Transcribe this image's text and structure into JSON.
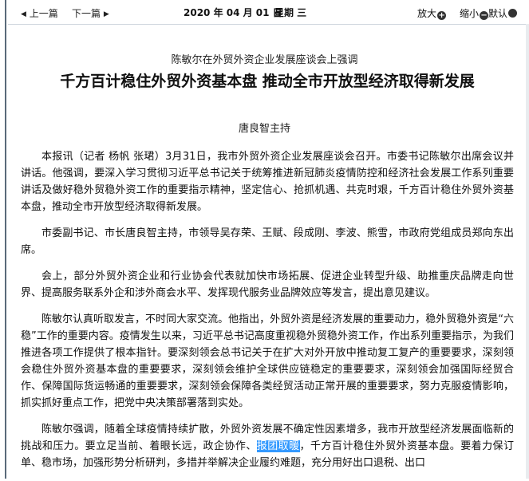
{
  "toolbar": {
    "prev_label": "上一篇",
    "next_label": "下一篇",
    "date": "2020 年 04 月 01 日",
    "weekday": "星期 三",
    "zoom_in_label": "放大",
    "zoom_out_label": "缩小",
    "reset_label": "默认"
  },
  "icons": {
    "prev": "triangle-left-icon",
    "next": "triangle-right-icon",
    "zoom_in": "plus-circle-icon",
    "zoom_out": "minus-circle-icon",
    "reset": "circle-icon"
  },
  "article": {
    "kicker": "陈敏尔在外贸外资企业发展座谈会上强调",
    "title": "千方百计稳住外贸外资基本盘  推动全市开放型经济取得新发展",
    "subtitle": "唐良智主持",
    "paragraphs": [
      "本报讯（记者 杨帆 张珺）3月31日，我市外贸外资企业发展座谈会召开。市委书记陈敏尔出席会议并讲话。他强调，要深入学习贯彻习近平总书记关于统筹推进新冠肺炎疫情防控和经济社会发展工作系列重要讲话及做好稳外贸稳外资工作的重要指示精神，坚定信心、抢抓机遇、共克时艰，千方百计稳住外贸外资基本盘，推动全市开放型经济取得新发展。",
      "市委副书记、市长唐良智主持，市领导吴存荣、王赋、段成刚、李波、熊雪，市政府党组成员郑向东出席。",
      "会上，部分外贸外资企业和行业协会代表就加快市场拓展、促进企业转型升级、助推重庆品牌走向世界、提高服务联系外企和涉外商会水平、发挥现代服务业品牌效应等发言，提出意见建议。",
      "陈敏尔认真听取发言，不时同大家交流。他指出，外贸外资是经济发展的重要动力，稳外贸稳外资是“六稳”工作的重要内容。疫情发生以来，习近平总书记高度重视稳外贸稳外资工作，作出系列重要指示，为我们推进各项工作提供了根本指针。要深刻领会总书记关于在扩大对外开放中推动复工复产的重要要求，深刻领会稳住外贸外资基本盘的重要要求，深刻领会维护全球供应链稳定的重要要求，深刻领会加强国际经贸合作、保障国际货运畅通的重要要求，深刻领会保障各类经贸活动正常开展的重要要求，努力克服疫情影响，抓实抓好重点工作，把党中央决策部署落到实处。"
    ],
    "last_before": "陈敏尔强调，随着全球疫情持续扩散，外贸外资发展不确定性因素增多，我市开放型经济发展面临新的挑战和压力。要立足当前、着眼长远，政企协作、",
    "last_highlight": "报团取暖",
    "last_after": "，千方百计稳住外贸外资基本盘。要着力保订单、稳市场，加强形势分析研判，多措并举解决企业履约难题，充分用好出口退税、出口"
  }
}
